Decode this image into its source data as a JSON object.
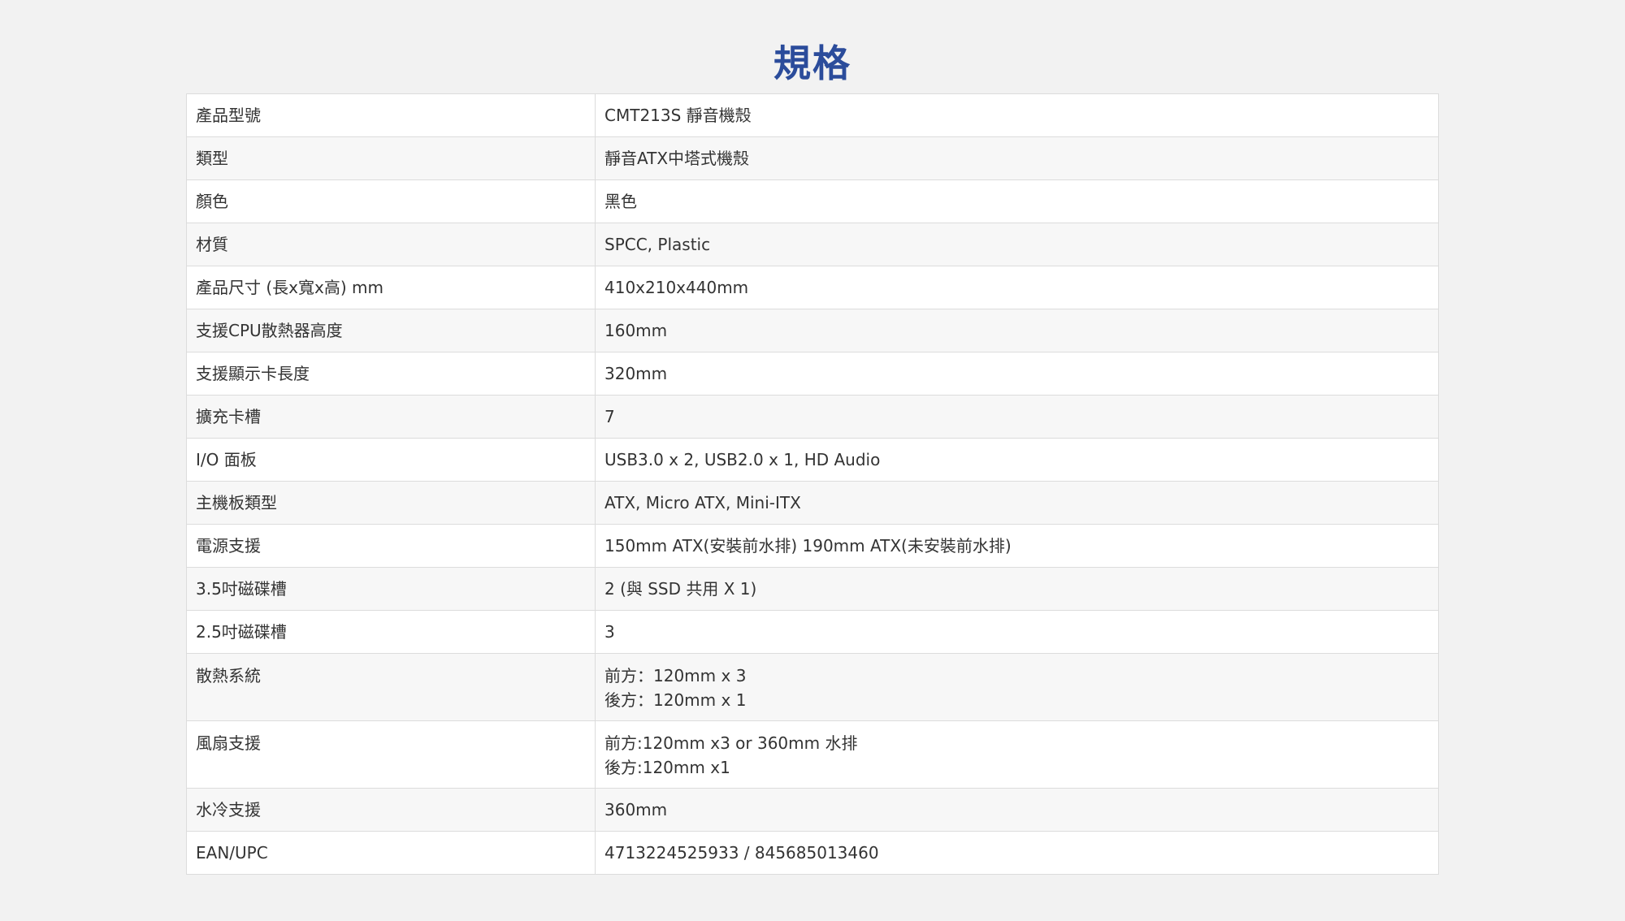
{
  "title": "規格",
  "specs": [
    {
      "label": "產品型號",
      "value": [
        "CMT213S 靜音機殼"
      ]
    },
    {
      "label": "類型",
      "value": [
        "靜音ATX中塔式機殼"
      ]
    },
    {
      "label": "顏色",
      "value": [
        "黑色"
      ]
    },
    {
      "label": "材質",
      "value": [
        "SPCC, Plastic"
      ]
    },
    {
      "label": "產品尺寸 (長x寬x高) mm",
      "value": [
        "410x210x440mm"
      ]
    },
    {
      "label": "支援CPU散熱器高度",
      "value": [
        "160mm"
      ]
    },
    {
      "label": "支援顯示卡長度",
      "value": [
        "320mm"
      ]
    },
    {
      "label": "擴充卡槽",
      "value": [
        "7"
      ]
    },
    {
      "label": "I/O 面板",
      "value": [
        "USB3.0 x 2, USB2.0 x 1, HD Audio"
      ]
    },
    {
      "label": "主機板類型",
      "value": [
        "ATX, Micro ATX, Mini-ITX"
      ]
    },
    {
      "label": "電源支援",
      "value": [
        "150mm ATX(安裝前水排) 190mm ATX(未安裝前水排)"
      ]
    },
    {
      "label": "3.5吋磁碟槽",
      "value": [
        "2 (與 SSD 共用 X 1)"
      ]
    },
    {
      "label": "2.5吋磁碟槽",
      "value": [
        "3"
      ]
    },
    {
      "label": "散熱系統",
      "value": [
        "前方：120mm x 3",
        "後方：120mm x 1"
      ]
    },
    {
      "label": "風扇支援",
      "value": [
        "前方:120mm x3 or 360mm 水排",
        "後方:120mm x1"
      ]
    },
    {
      "label": "水冷支援",
      "value": [
        "360mm"
      ]
    },
    {
      "label": "EAN/UPC",
      "value": [
        "4713224525933 / 845685013460"
      ]
    }
  ]
}
